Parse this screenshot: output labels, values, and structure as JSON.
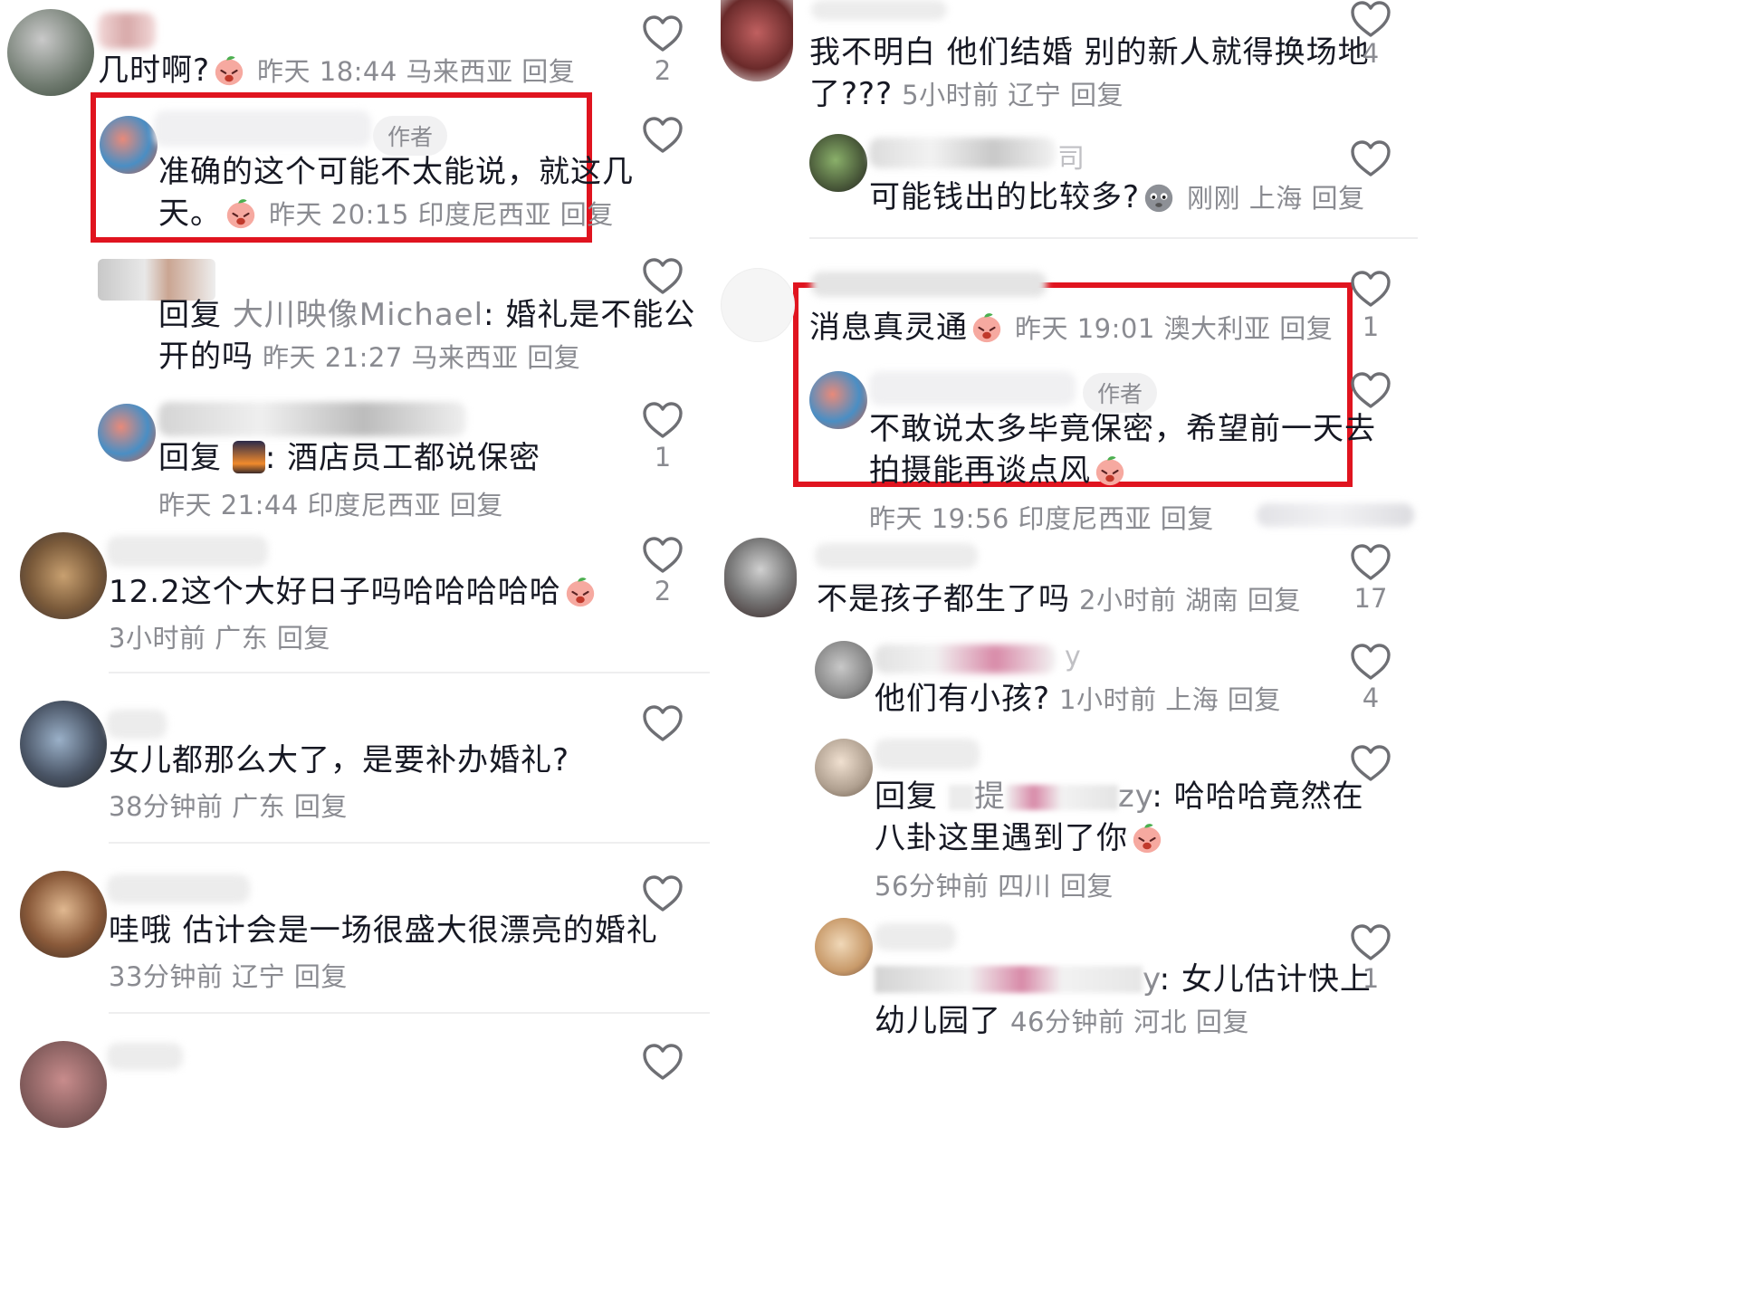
{
  "left": {
    "c1": {
      "text": "几时啊?",
      "meta": "昨天 18:44 马来西亚 回复",
      "likes": "2"
    },
    "c2": {
      "badge": "作者",
      "line1": "准确的这个可能不太能说，就这几",
      "line2": "天。",
      "meta": "昨天 20:15 印度尼西亚 回复"
    },
    "c3": {
      "reply_word": "回复",
      "reply_to": "大川映像Michael",
      "line1_rest": ": 婚礼是不能公",
      "line2": "开的吗",
      "meta": "昨天 21:27 马来西亚 回复"
    },
    "c4": {
      "reply_word": "回复",
      "line1_rest": ": 酒店员工都说保密",
      "meta": "昨天 21:44 印度尼西亚 回复",
      "likes": "1"
    },
    "c5": {
      "text": "12.2这个大好日子吗哈哈哈哈哈",
      "meta": "3小时前 广东 回复",
      "likes": "2"
    },
    "c6": {
      "text": "女儿都那么大了，是要补办婚礼?",
      "meta": "38分钟前 广东 回复"
    },
    "c7": {
      "text": "哇哦 估计会是一场很盛大很漂亮的婚礼",
      "meta": "33分钟前 辽宁 回复"
    }
  },
  "right": {
    "r1": {
      "line1": "我不明白 他们结婚 别的新人就得换场地",
      "line2": "了???",
      "meta": "5小时前 辽宁 回复",
      "likes": "4"
    },
    "r2": {
      "username_tail": "司",
      "text": "可能钱出的比较多?",
      "meta": "刚刚 上海 回复"
    },
    "r3": {
      "text": "消息真灵通",
      "meta": "昨天 19:01 澳大利亚 回复",
      "likes": "1"
    },
    "r4": {
      "badge": "作者",
      "line1": "不敢说太多毕竟保密，希望前一天去",
      "line2": "拍摄能再谈点风",
      "meta": "昨天 19:56 印度尼西亚 回复"
    },
    "r5": {
      "text": "不是孩子都生了吗",
      "meta": "2小时前 湖南 回复",
      "likes": "17"
    },
    "r6": {
      "username_tail": "y",
      "text": "他们有小孩?",
      "meta": "1小时前 上海 回复",
      "likes": "4"
    },
    "r7": {
      "reply_word": "回复",
      "reply_to_a": "提",
      "reply_to_b": "zy",
      "line1_rest": ": 哈哈哈竟然在",
      "line2": "八卦这里遇到了你",
      "meta": "56分钟前 四川 回复"
    },
    "r8": {
      "reply_to_b": "y",
      "line1_rest": ": 女儿估计快上",
      "line2": "幼儿园了",
      "meta": "46分钟前 河北 回复",
      "likes": "1"
    }
  },
  "colors": {
    "highlight_box": "#e0141f",
    "meta_text": "#8a8b91",
    "body_text": "#161823"
  }
}
